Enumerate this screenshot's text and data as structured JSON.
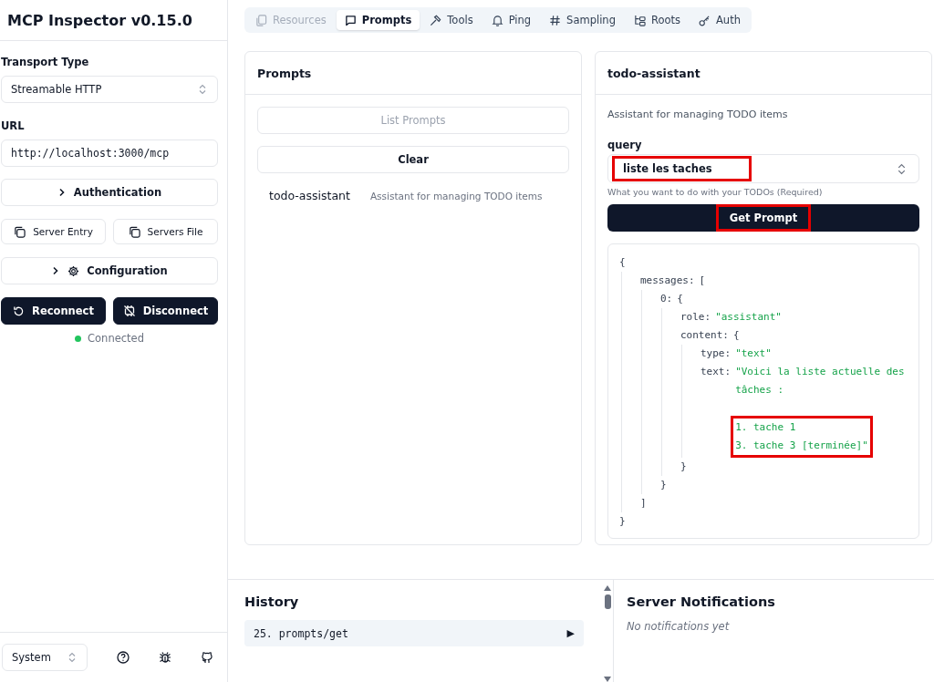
{
  "sidebar": {
    "title": "MCP Inspector v0.15.0",
    "transport": {
      "label": "Transport Type",
      "value": "Streamable HTTP"
    },
    "url": {
      "label": "URL",
      "value": "http://localhost:3000/mcp"
    },
    "authentication": {
      "label": "Authentication",
      "expanded": false
    },
    "server_entry": "Server Entry",
    "servers_file": "Servers File",
    "configuration": {
      "label": "Configuration",
      "expanded": false
    },
    "reconnect": "Reconnect",
    "disconnect": "Disconnect",
    "status": {
      "label": "Connected",
      "connected": true
    },
    "theme": "System"
  },
  "tabs": [
    {
      "label": "Resources",
      "selected": false,
      "disabled": true
    },
    {
      "label": "Prompts",
      "selected": true,
      "disabled": false
    },
    {
      "label": "Tools",
      "selected": false,
      "disabled": false
    },
    {
      "label": "Ping",
      "selected": false,
      "disabled": false
    },
    {
      "label": "Sampling",
      "selected": false,
      "disabled": false
    },
    {
      "label": "Roots",
      "selected": false,
      "disabled": false
    },
    {
      "label": "Auth",
      "selected": false,
      "disabled": false
    }
  ],
  "prompts_panel": {
    "title": "Prompts",
    "list_button": {
      "label": "List Prompts",
      "disabled": true
    },
    "clear_button": {
      "label": "Clear",
      "disabled": false
    },
    "items": [
      {
        "name": "todo-assistant",
        "description": "Assistant for managing TODO items"
      }
    ]
  },
  "detail_panel": {
    "title": "todo-assistant",
    "description": "Assistant for managing TODO items",
    "field": {
      "label": "query",
      "value": "liste les taches",
      "hint": "What you want to do with your TODOs (Required)",
      "highlighted": true
    },
    "get_button": {
      "label": "Get Prompt",
      "highlighted": true
    },
    "result": {
      "open": "{",
      "close": "}",
      "children": [
        {
          "key": "messages:",
          "open": "[",
          "close": "]",
          "children": [
            {
              "key": "0:",
              "open": "{",
              "close": "}",
              "children": [
                {
                  "key": "role:",
                  "value": "\"assistant\""
                },
                {
                  "key": "content:",
                  "open": "{",
                  "close": "}",
                  "children": [
                    {
                      "key": "type:",
                      "value": "\"text\""
                    },
                    {
                      "key": "text:",
                      "value": "\"Voici la liste actuelle des tâches :",
                      "extra_lines": [
                        "1. tache 1",
                        "3. tache 3 [terminée]\""
                      ],
                      "highlighted": true
                    }
                  ]
                }
              ]
            }
          ]
        }
      ]
    }
  },
  "history": {
    "title": "History",
    "items": [
      {
        "label": "25. prompts/get",
        "toggle": "▶"
      }
    ]
  },
  "notifications": {
    "title": "Server Notifications",
    "empty": "No notifications yet"
  }
}
